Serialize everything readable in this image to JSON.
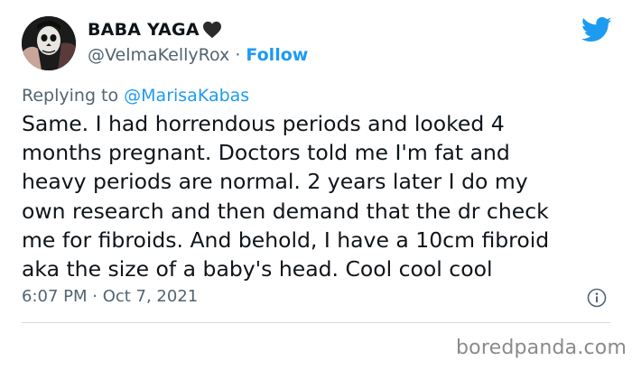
{
  "tweet": {
    "author": {
      "name": "BABA YAGA",
      "handle": "@VelmaKellyRox",
      "separator": "·",
      "follow_label": "Follow"
    },
    "reply_prefix": "Replying to ",
    "reply_to": "@MarisaKabas",
    "text_lines": [
      "Same. I had horrendous periods and looked 4",
      "months pregnant. Doctors told me I'm fat and",
      "heavy periods are normal. 2 years later I do my",
      "own research and then demand that the dr check",
      "me for fibroids. And behold, I have a 10cm fibroid",
      "aka the size of a baby's head. Cool cool cool"
    ],
    "timestamp": "6:07 PM · Oct 7, 2021"
  },
  "icons": {
    "verified_emoji": "black-heart-icon",
    "platform": "twitter-bird-icon",
    "info": "info-icon"
  },
  "watermark": "boredpanda.com",
  "colors": {
    "accent": "#1d9bf0",
    "secondary_text": "#536471",
    "primary_text": "#0f1419"
  }
}
